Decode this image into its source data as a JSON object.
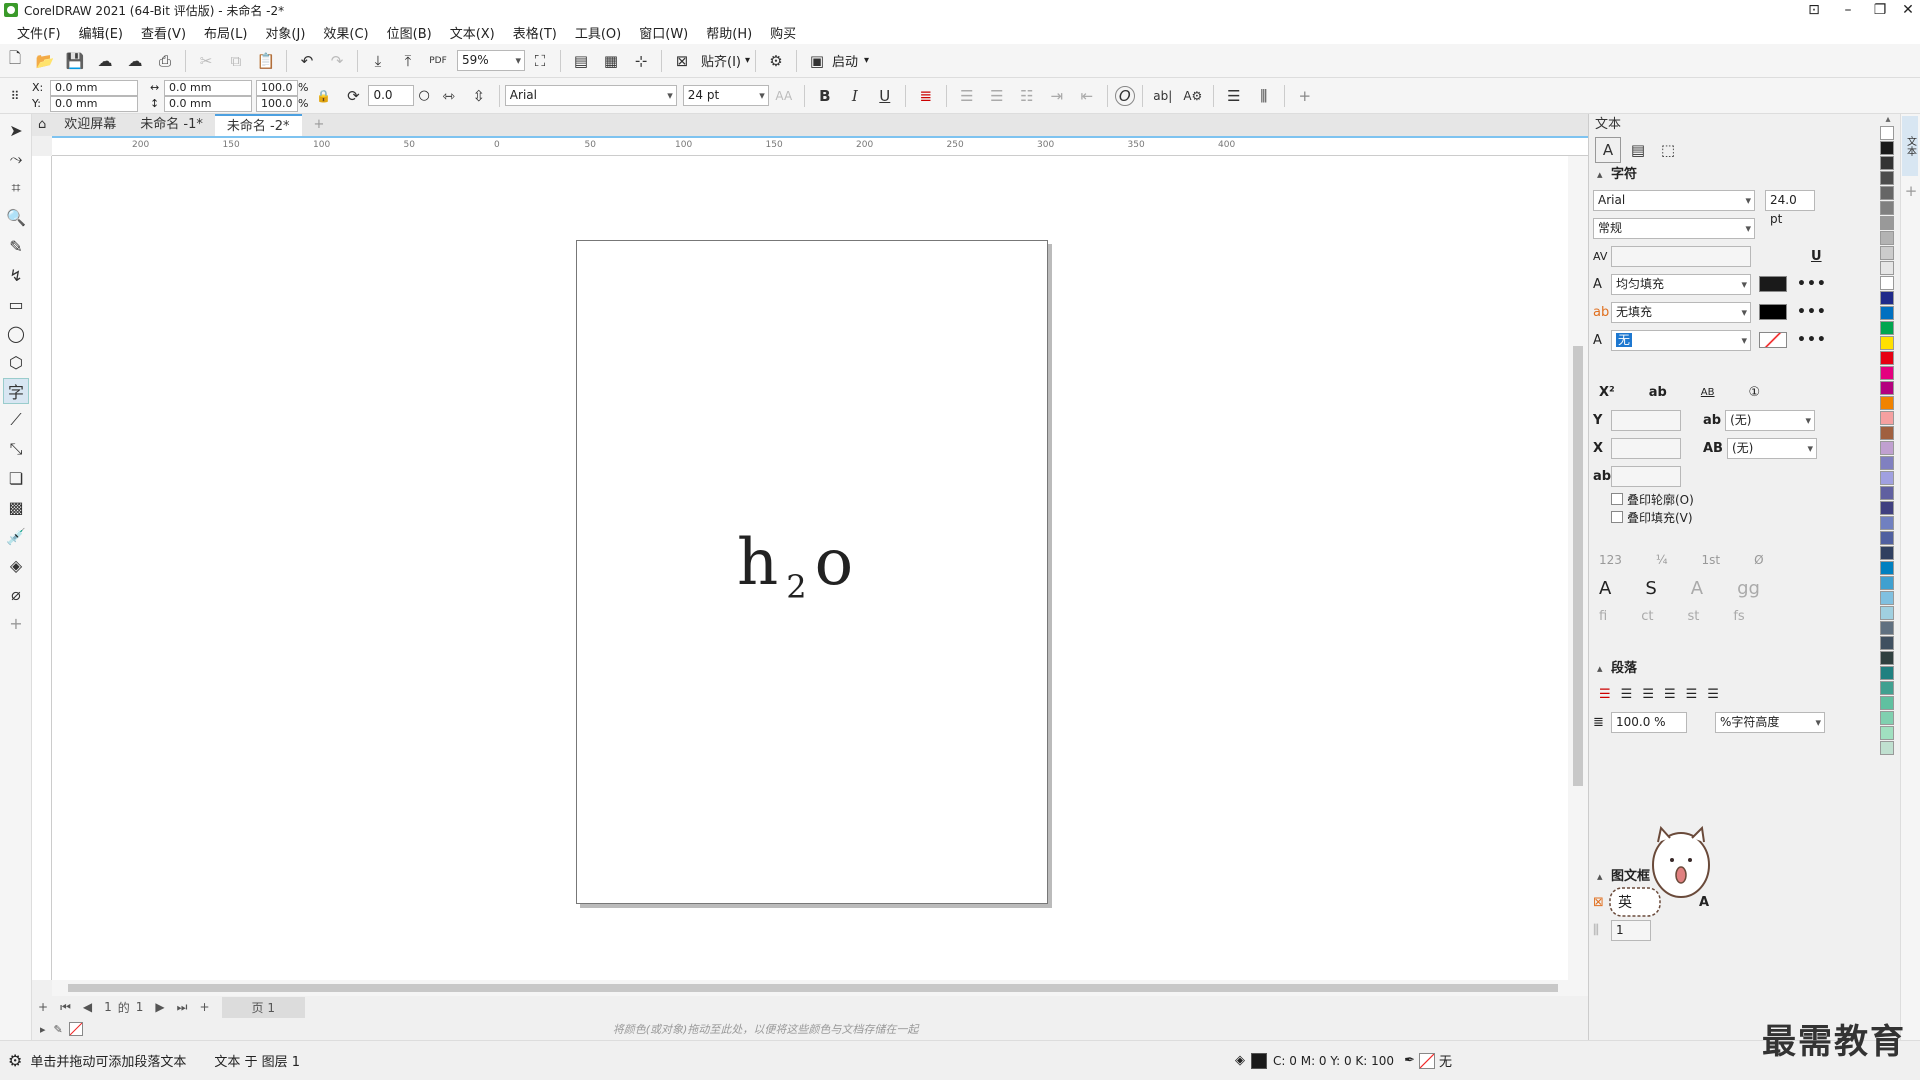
{
  "titlebar": {
    "title": "CorelDRAW 2021 (64-Bit 评估版) - 未命名 -2*"
  },
  "menu": [
    "文件(F)",
    "编辑(E)",
    "查看(V)",
    "布局(L)",
    "对象(J)",
    "效果(C)",
    "位图(B)",
    "文本(X)",
    "表格(T)",
    "工具(O)",
    "窗口(W)",
    "帮助(H)",
    "购买"
  ],
  "toolbar": {
    "zoom": "59%",
    "snap_label": "贴齐(I)",
    "launch_label": "启动"
  },
  "propbar": {
    "x": "0.0 mm",
    "y": "0.0 mm",
    "w": "0.0 mm",
    "h": "0.0 mm",
    "scale_x": "100.0",
    "scale_y": "100.0",
    "pct": "%",
    "rotation": "0.0",
    "font": "Arial",
    "size": "24 pt",
    "x_label": "X:",
    "y_label": "Y:"
  },
  "tabs": [
    "欢迎屏幕",
    "未命名 -1*",
    "未命名 -2*"
  ],
  "ruler_h": [
    "200",
    "150",
    "100",
    "50",
    "0",
    "50",
    "100",
    "150",
    "200",
    "250",
    "300",
    "350",
    "400"
  ],
  "canvas": {
    "text_h": "h",
    "text_sub": "2",
    "text_o": "o"
  },
  "pagenav": {
    "pos": "1",
    "of": "的",
    "total": "1",
    "page_tab": "页 1"
  },
  "colorbar": {
    "hint": "将颜色(或对象)拖动至此处，以便将这些颜色与文档存储在一起"
  },
  "status": {
    "left1": "单击并拖动可添加段落文本",
    "left2": "文本 于 图层 1",
    "cmyk": "C: 0 M: 0 Y: 0 K: 100",
    "none": "无"
  },
  "panel": {
    "title": "文本",
    "char_section": "字符",
    "font": "Arial",
    "size": "24.0 pt",
    "style": "常规",
    "fill_uniform": "均匀填充",
    "fill_none": "无填充",
    "outline_none": "无",
    "y_none": "(无)",
    "x_none": "(无)",
    "overprint_outline": "叠印轮廓(O)",
    "overprint_fill": "叠印填充(V)",
    "para_section": "段落",
    "line_spacing": "100.0 %",
    "spacing_unit": "%字符高度",
    "frame_section": "图文框",
    "frame_cols": "1",
    "cat_text": "英"
  },
  "watermark": "最需教育",
  "palette_colors": [
    "#ffffff",
    "#1a1a1a",
    "#333333",
    "#4d4d4d",
    "#666666",
    "#808080",
    "#999999",
    "#b3b3b3",
    "#cccccc",
    "#e6e6e6",
    "#ffffff",
    "#1f2a8a",
    "#0070c0",
    "#00a650",
    "#ffe000",
    "#e60012",
    "#e4007f",
    "#b4007f",
    "#f08300",
    "#f5a0a0",
    "#a06040",
    "#c0a0d0",
    "#8080c0",
    "#a0a0e0",
    "#6060a0",
    "#404080",
    "#7080c0",
    "#5060a0",
    "#304060",
    "#0080c0",
    "#40a0d0",
    "#80c0e0",
    "#a0d0e0",
    "#607080",
    "#405060",
    "#304040",
    "#208080",
    "#40a090",
    "#60c0a0",
    "#80d0b0",
    "#a0e0c0",
    "#c0e0d0"
  ]
}
